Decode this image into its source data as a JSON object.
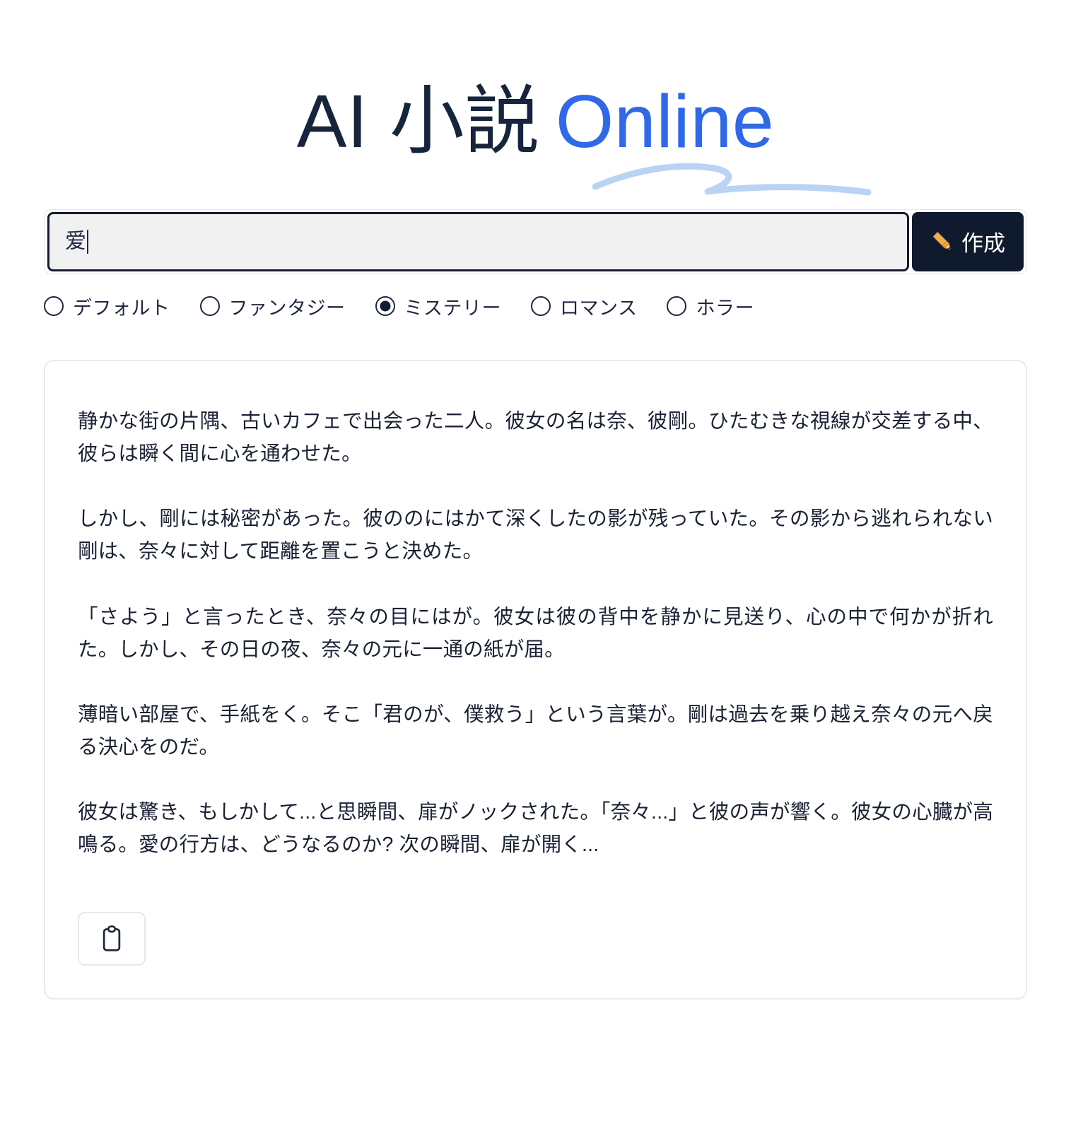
{
  "app": {
    "logo": {
      "part_dark": "AI 小説",
      "part_blue": "Online",
      "color_dark": "#16243c",
      "color_blue": "#2f68e8",
      "swoosh_color": "#b9d3f4",
      "icon": "swoosh-underline"
    }
  },
  "prompt": {
    "value": "爱",
    "placeholder": "",
    "create_label": "作成",
    "create_icon": "pencil-icon",
    "button_color": "#101a2e"
  },
  "genres": {
    "selected": "ミステリー",
    "options": [
      {
        "label": "デフォルト",
        "checked": false
      },
      {
        "label": "ファンタジー",
        "checked": false
      },
      {
        "label": "ミステリー",
        "checked": true
      },
      {
        "label": "ロマンス",
        "checked": false
      },
      {
        "label": "ホラー",
        "checked": false
      }
    ]
  },
  "result": {
    "paragraphs": [
      "静かな街の片隅、古いカフェで出会った二人。彼女の名は奈、彼剛。ひたむきな視線が交差する中、彼らは瞬く間に心を通わせた。",
      "しかし、剛には秘密があった。彼ののにはかて深くしたの影が残っていた。その影から逃れられない剛は、奈々に対して距離を置こうと決めた。",
      "「さよう」と言ったとき、奈々の目にはが。彼女は彼の背中を静かに見送り、心の中で何かが折れた。しかし、その日の夜、奈々の元に一通の紙が届。",
      "薄暗い部屋で、手紙をく。そこ「君のが、僕救う」という言葉が。剛は過去を乗り越え奈々の元へ戻る決心をのだ。",
      "彼女は驚き、もしかして...と思瞬間、扉がノックされた。「奈々...」と彼の声が響く。彼女の心臓が高鳴る。愛の行方は、どうなるのか? 次の瞬間、扉が開く..."
    ],
    "copy_icon": "clipboard-icon"
  }
}
